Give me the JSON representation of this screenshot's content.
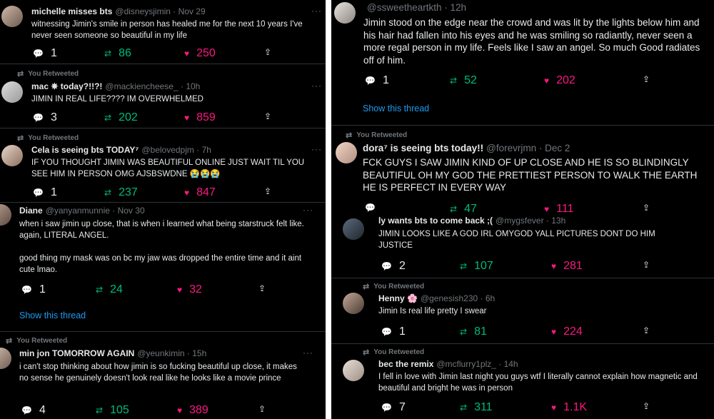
{
  "ui": {
    "retweeted_label": "You Retweeted",
    "show_thread": "Show this thread",
    "more": "···",
    "icons": {
      "reply": "reply-icon",
      "retweet": "retweet-icon",
      "like": "heart-icon",
      "share": "share-icon"
    },
    "colors": {
      "retweet": "#00ba7c",
      "like": "#f91880",
      "link": "#1d9bf0",
      "muted": "#71767b"
    }
  },
  "left": [
    {
      "name": "michelle misses bts",
      "handle": "@disneysjimin",
      "time": "· Nov 29",
      "text": "witnessing Jimin's smile in person has healed me for the next 10 years I've never seen someone so beautiful in my life",
      "replies": "1",
      "retweets": "86",
      "likes": "250"
    },
    {
      "name": "mac ✵ today?!!?!",
      "handle": "@mackiencheese_",
      "time": "· 10h",
      "text": "JIMIN IN REAL LIFE???? IM OVERWHELMED",
      "replies": "3",
      "retweets": "202",
      "likes": "859"
    },
    {
      "name": "Cela is seeing bts TODAY⁷",
      "handle": "@belovedpjm",
      "time": "· 7h",
      "text": "IF YOU THOUGHT JIMIN WAS BEAUTIFUL ONLINE JUST WAIT TIL YOU SEE HIM IN PERSON OMG AJSBSWDNE 😭😭😭",
      "replies": "1",
      "retweets": "237",
      "likes": "847"
    },
    {
      "name": "Diane",
      "handle": "@yanyanmunnie",
      "time": "· Nov 30",
      "text": "when i saw jimin up close, that is when i learned what being starstruck felt like. again, LITERAL ANGEL.\n\ngood thing my mask was on bc my jaw was dropped the entire time and it aint cute lmao.",
      "replies": "1",
      "retweets": "24",
      "likes": "32"
    },
    {
      "name": "min jon TOMORROW AGAIN",
      "handle": "@yeunkimin",
      "time": "· 15h",
      "text": "i can't stop thinking about how jimin is so fucking beautiful up close, it makes no sense he genuinely doesn't look real like he looks like a movie prince",
      "replies": "4",
      "retweets": "105",
      "likes": "389"
    }
  ],
  "right": [
    {
      "name": "",
      "handle": "@ssweetheartkth",
      "time": "· 12h",
      "text": "Jimin stood on the edge near the crowd and was lit by the lights below him and his hair had fallen into his eyes and he was smiling so radiantly, never seen a more regal person in my life. Feels like I saw an angel. So much Good radiates off of him.",
      "replies": "1",
      "retweets": "52",
      "likes": "202"
    },
    {
      "name": "dora⁷ is seeing bts today!!",
      "handle": "@forevrjmn",
      "time": "· Dec 2",
      "text": "FCK GUYS I SAW JIMIN KIND OF UP CLOSE AND HE IS SO BLINDINGLY BEAUTIFUL OH MY GOD THE PRETTIEST PERSON TO WALK THE EARTH HE IS PERFECT IN EVERY WAY",
      "replies": "",
      "retweets": "47",
      "likes": "111"
    },
    {
      "name": "ly wants bts to come back ;(",
      "handle": "@mygsfever",
      "time": "· 13h",
      "text": "JIMIN LOOKS LIKE A GOD IRL OMYGOD YALL PICTURES DONT DO HIM JUSTICE",
      "replies": "2",
      "retweets": "107",
      "likes": "281"
    },
    {
      "name": "Henny 🌸",
      "handle": "@genesish230",
      "time": "· 6h",
      "text": "Jimin Is real life pretty I swear",
      "replies": "1",
      "retweets": "81",
      "likes": "224"
    },
    {
      "name": "bec the remix",
      "handle": "@mcflurry1plz_",
      "time": "· 14h",
      "text": "I fell in love with Jimin last night you guys wtf I literally cannot explain how magnetic and beautiful and bright he was in person",
      "replies": "7",
      "retweets": "311",
      "likes": "1.1K"
    }
  ]
}
